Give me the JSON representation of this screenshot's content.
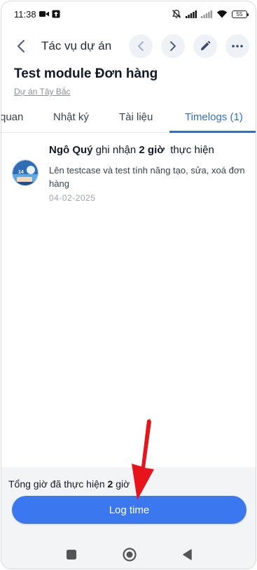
{
  "status_bar": {
    "time": "11:38",
    "battery": "55"
  },
  "header": {
    "title": "Tác vụ dự án"
  },
  "task": {
    "title": "Test module Đơn hàng",
    "project": "Dự án Tây Bắc"
  },
  "tabs": [
    {
      "label": "quan"
    },
    {
      "label": "Nhật ký"
    },
    {
      "label": "Tài liệu"
    },
    {
      "label": "Timelogs (1)"
    }
  ],
  "timelog": {
    "user": "Ngô Quý",
    "action": " ghi nhận ",
    "hours": "2 giờ",
    "suffix": "  thực hiện",
    "description": "Lên testcase và test tính năng tạo, sửa, xoá đơn hàng",
    "date": "04-02-2025",
    "avatar_badge": "14"
  },
  "footer": {
    "total_prefix": "Tổng giờ đã thực hiện ",
    "total_hours": "2",
    "total_suffix": " giờ",
    "button_label": "Log time"
  },
  "colors": {
    "accent": "#2f6fd6",
    "button": "#3b78f0",
    "annotation_arrow": "#e8141b"
  },
  "icons": {
    "status_left": [
      "video-camera-icon",
      "upload-box-icon"
    ],
    "status_right": [
      "bell-off-icon",
      "signal-icon",
      "signal-icon",
      "wifi-icon",
      "battery-icon"
    ],
    "header": [
      "back-arrow-icon",
      "chevron-left-icon",
      "chevron-right-icon",
      "pencil-icon",
      "more-dots-icon"
    ],
    "navbar": [
      "square-icon",
      "circle-icon",
      "triangle-back-icon"
    ]
  }
}
